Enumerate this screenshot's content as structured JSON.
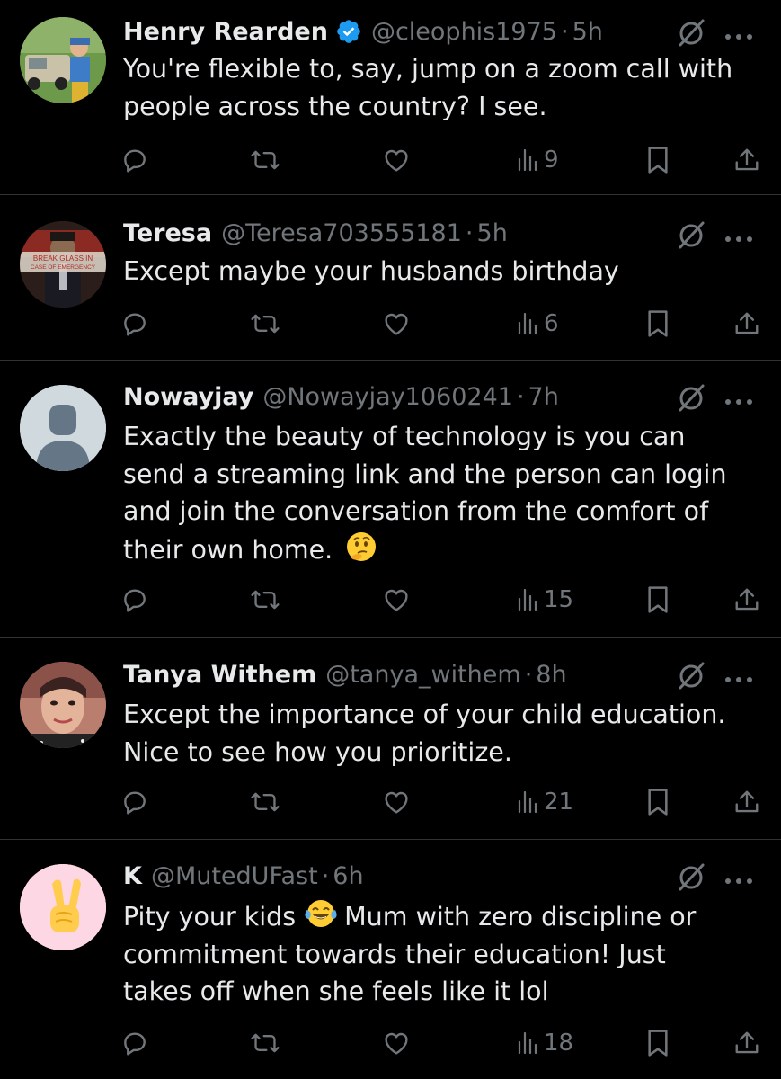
{
  "colors": {
    "background": "#000000",
    "text": "#e7e9ea",
    "muted": "#71767b",
    "divider": "#2f3336",
    "verified": "#1d9bf0"
  },
  "tweets": [
    {
      "name": "Henry Rearden",
      "verified": true,
      "handle": "@cleophis1975",
      "separator": "·",
      "time": "5h",
      "lines": [
        "You're flexible to, say, jump on a zoom call with",
        "people across the country?  I see."
      ],
      "views": "9",
      "avatar": "photo-man-with-truck"
    },
    {
      "name": "Teresa",
      "verified": false,
      "handle": "@Teresa703555181",
      "separator": "·",
      "time": "5h",
      "lines": [
        "Except maybe your husbands birthday"
      ],
      "views": "6",
      "avatar": "break-glass-sign",
      "avatar_text": [
        "BREAK GLASS IN",
        "CASE OF EMERGENCY"
      ]
    },
    {
      "name": "Nowayjay",
      "verified": false,
      "handle": "@Nowayjay1060241",
      "separator": "·",
      "time": "7h",
      "lines": [
        "Exactly the beauty of technology is you can",
        "send a streaming link and the person can login",
        "and join the conversation from the comfort of",
        "their own home."
      ],
      "emoji_after_last_line": "thinking-face-emoji",
      "views": "15",
      "avatar": "default-profile"
    },
    {
      "name": "Tanya Withem",
      "verified": false,
      "handle": "@tanya_withem",
      "separator": "·",
      "time": "8h",
      "lines": [
        "Except the importance of your child education.",
        "Nice to see how you prioritize."
      ],
      "views": "21",
      "avatar": "photo-woman"
    },
    {
      "name": "K",
      "verified": false,
      "handle": "@MutedUFast",
      "separator": "·",
      "time": "6h",
      "line1_before": "Pity your kids",
      "line1_emoji": "tears-of-joy-emoji",
      "line1_after": "Mum with zero discipline or",
      "lines": [
        "commitment towards their education! Just",
        "takes off when she feels like it lol"
      ],
      "views": "18",
      "avatar": "victory-hand-emoji"
    }
  ],
  "icons": [
    "reply-icon",
    "repost-icon",
    "like-icon",
    "views-icon",
    "bookmark-icon",
    "share-icon",
    "grok-icon",
    "more-icon",
    "verified-icon"
  ]
}
